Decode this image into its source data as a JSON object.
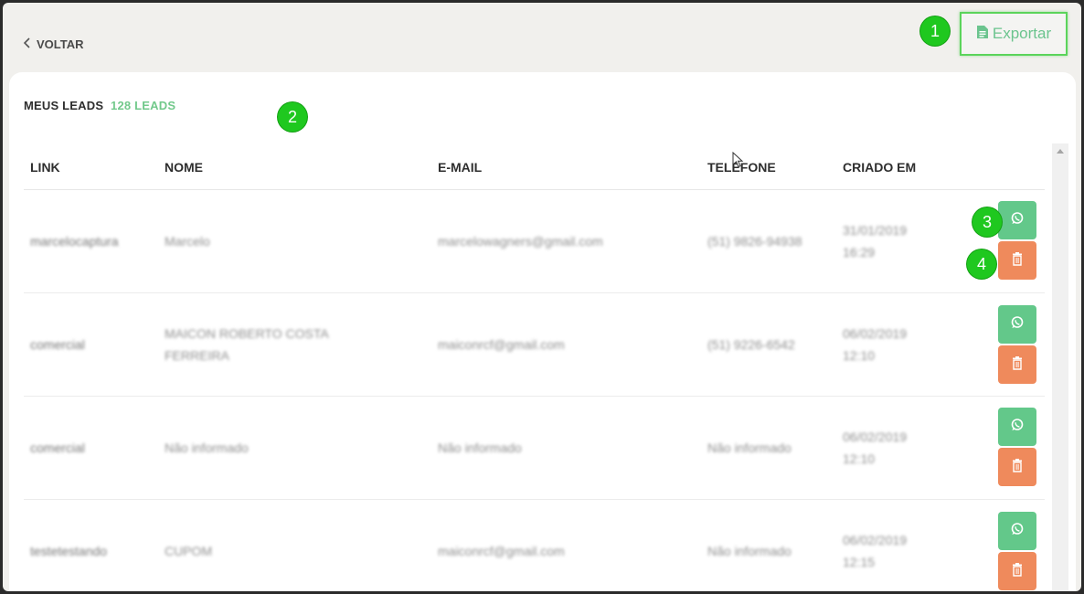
{
  "header": {
    "back_label": "VOLTAR",
    "export_label": "Exportar"
  },
  "card": {
    "title": "MEUS LEADS",
    "count": "128 LEADS"
  },
  "table": {
    "columns": [
      "LINK",
      "NOME",
      "E-MAIL",
      "TELEFONE",
      "CRIADO EM"
    ],
    "rows": [
      {
        "link": "marcelocaptura",
        "nome": "Marcelo",
        "email": "marcelowagners@gmail.com",
        "telefone": "(51) 9826-94938",
        "data": "31/01/2019",
        "hora": "16:29"
      },
      {
        "link": "comercial",
        "nome": "MAICON ROBERTO COSTA FERREIRA",
        "email": "maiconrcf@gmail.com",
        "telefone": "(51) 9226-6542",
        "data": "06/02/2019",
        "hora": "12:10"
      },
      {
        "link": "comercial",
        "nome": "Não informado",
        "email": "Não informado",
        "telefone": "Não informado",
        "data": "06/02/2019",
        "hora": "12:10"
      },
      {
        "link": "testetestando",
        "nome": "CUPOM",
        "email": "maiconrcf@gmail.com",
        "telefone": "Não informado",
        "data": "06/02/2019",
        "hora": "12:15"
      }
    ]
  },
  "markers": [
    "1",
    "2",
    "3",
    "4"
  ],
  "icons": {
    "back": "chevron-left-icon",
    "export": "document-icon",
    "whatsapp": "whatsapp-icon",
    "delete": "trash-icon"
  },
  "colors": {
    "accent_green": "#72c98b",
    "whatsapp_button": "#63c88a",
    "delete_button": "#ef8a5c",
    "marker": "#1fc81f",
    "export_border": "#5bd45b"
  }
}
